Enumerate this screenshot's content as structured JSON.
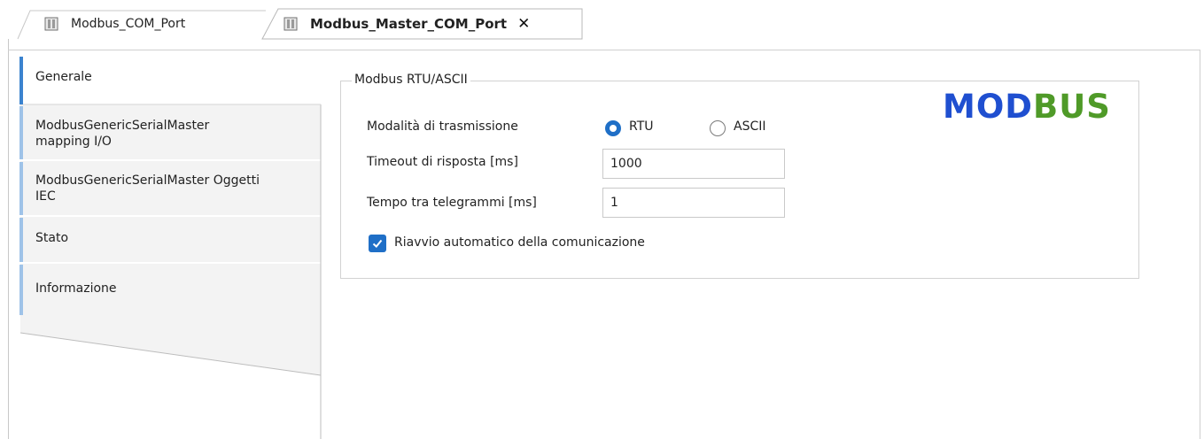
{
  "tabs": [
    {
      "label": "Modbus_COM_Port",
      "icon": "device-icon",
      "active": false
    },
    {
      "label": "Modbus_Master_COM_Port",
      "icon": "device-icon",
      "active": true,
      "close": "✕"
    }
  ],
  "nav": {
    "items": [
      {
        "lines": [
          "Generale"
        ],
        "selected": true
      },
      {
        "lines": [
          "ModbusGenericSerialMaster",
          "mapping I/O"
        ],
        "selected": false
      },
      {
        "lines": [
          "ModbusGenericSerialMaster Oggetti",
          "IEC"
        ],
        "selected": false
      },
      {
        "lines": [
          "Stato"
        ],
        "selected": false
      },
      {
        "lines": [
          "Informazione"
        ],
        "selected": false
      }
    ]
  },
  "group": {
    "title": "Modbus RTU/ASCII",
    "logo": {
      "part1": "MOD",
      "part2": "BUS"
    },
    "transmission": {
      "label": "Modalità di trasmissione",
      "options": [
        {
          "label": "RTU",
          "selected": true
        },
        {
          "label": "ASCII",
          "selected": false
        }
      ]
    },
    "timeout": {
      "label": "Timeout di risposta [ms]",
      "value": "1000"
    },
    "interframe": {
      "label": "Tempo tra telegrammi [ms]",
      "value": "1"
    },
    "auto_restart": {
      "label": "Riavvio automatico della comunicazione",
      "checked": true
    }
  },
  "colors": {
    "accent": "#1f6fc7",
    "nav_accent": "#9fc3e8",
    "logo_blue": "#1f4fd0",
    "logo_green": "#4f9a28"
  }
}
